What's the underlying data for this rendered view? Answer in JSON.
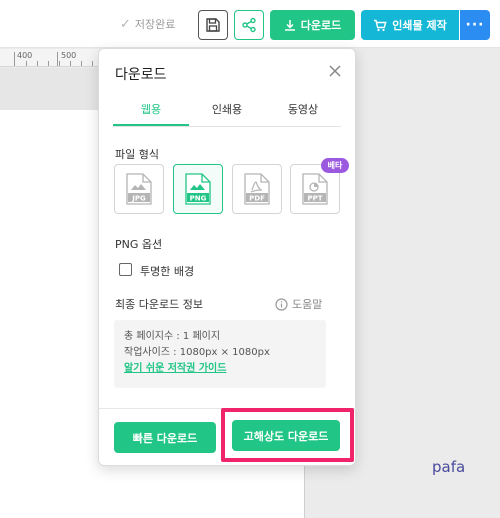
{
  "toolbar": {
    "save_status": "저장완료",
    "download_label": "다운로드",
    "print_label": "인쇄물 제작",
    "more_label": "···"
  },
  "ruler": {
    "labels": [
      "400",
      "500"
    ]
  },
  "popup": {
    "title": "다운로드",
    "tabs": [
      {
        "label": "웹용",
        "active": true
      },
      {
        "label": "인쇄용",
        "active": false
      },
      {
        "label": "동영상",
        "active": false
      }
    ],
    "file_format_label": "파일 형식",
    "formats": [
      {
        "label": "JPG",
        "active": false
      },
      {
        "label": "PNG",
        "active": true
      },
      {
        "label": "PDF",
        "active": false
      },
      {
        "label": "PPT",
        "active": false
      }
    ],
    "beta_badge": "베타",
    "png_options_label": "PNG 옵션",
    "transparent_bg_label": "투명한 배경",
    "transparent_bg_checked": false,
    "final_info_label": "최종 다운로드 정보",
    "help_label": "도움말",
    "info": {
      "total_pages": "총 페이지수 : 1 페이지",
      "work_size": "작업사이즈 : 1080px × 1080px",
      "copyright_link": "알기 쉬운 저작권 가이드"
    },
    "quick_download": "빠른 다운로드",
    "hq_download": "고해상도 다운로드"
  },
  "canvas_text": "pafa",
  "colors": {
    "accent_green": "#21c586",
    "print_cyan": "#14b8d6",
    "more_blue": "#2b8df2",
    "highlight_pink": "#f0246a",
    "beta_purple": "#9b59e0"
  }
}
